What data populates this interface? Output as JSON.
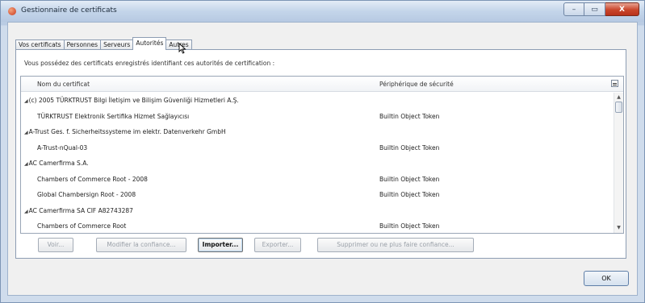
{
  "window": {
    "title": "Gestionnaire de certificats",
    "controls": [
      "–",
      "▭",
      "X"
    ]
  },
  "tabs": [
    {
      "label": "Vos certificats",
      "active": false
    },
    {
      "label": "Personnes",
      "active": false
    },
    {
      "label": "Serveurs",
      "active": false
    },
    {
      "label": "Autorités",
      "active": true
    },
    {
      "label": "Autres",
      "active": false
    }
  ],
  "intro": "Vous possédez des certificats enregistrés identifiant ces autorités de certification :",
  "columns": {
    "name": "Nom du certificat",
    "device": "Périphérique de sécurité"
  },
  "rows": [
    {
      "type": "group",
      "twisty": "◢",
      "name": "(c) 2005 TÜRKTRUST Bilgi İletişim ve Bilişim Güvenliği Hizmetleri A.Ş.",
      "device": ""
    },
    {
      "type": "item",
      "twisty": "",
      "name": "TÜRKTRUST Elektronik Sertifika Hizmet Sağlayıcısı",
      "device": "Builtin Object Token"
    },
    {
      "type": "group",
      "twisty": "◢",
      "name": "A-Trust Ges. f. Sicherheitssysteme im elektr. Datenverkehr GmbH",
      "device": ""
    },
    {
      "type": "item",
      "twisty": "",
      "name": "A-Trust-nQual-03",
      "device": "Builtin Object Token"
    },
    {
      "type": "group",
      "twisty": "◢",
      "name": "AC Camerfirma S.A.",
      "device": ""
    },
    {
      "type": "item",
      "twisty": "",
      "name": "Chambers of Commerce Root - 2008",
      "device": "Builtin Object Token"
    },
    {
      "type": "item",
      "twisty": "",
      "name": "Global Chambersign Root - 2008",
      "device": "Builtin Object Token"
    },
    {
      "type": "group",
      "twisty": "◢",
      "name": "AC Camerfirma SA CIF A82743287",
      "device": ""
    },
    {
      "type": "item",
      "twisty": "",
      "name": "Chambers of Commerce Root",
      "device": "Builtin Object Token"
    }
  ],
  "buttons": {
    "view": "Voir...",
    "edit_trust": "Modifier la confiance...",
    "import": "Importer...",
    "export": "Exporter...",
    "delete": "Supprimer ou ne plus faire confiance...",
    "ok": "OK"
  },
  "icons": {
    "title_icon": "certificate-manager-icon",
    "column_picker": "column-picker-icon",
    "cursor": "mouse-pointer-icon"
  }
}
